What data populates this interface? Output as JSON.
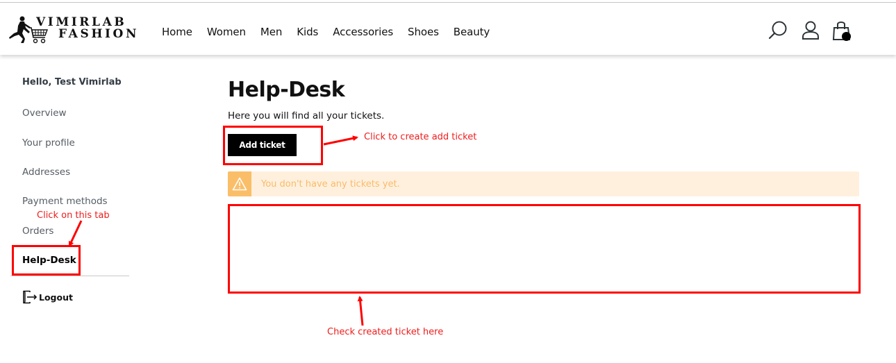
{
  "brand": {
    "line1": "VIMIRLAB",
    "line2": "FASHION",
    "logo_icon": "shopper-with-cart-icon"
  },
  "nav": {
    "items": [
      {
        "label": "Home"
      },
      {
        "label": "Women"
      },
      {
        "label": "Men"
      },
      {
        "label": "Kids"
      },
      {
        "label": "Accessories"
      },
      {
        "label": "Shoes"
      },
      {
        "label": "Beauty"
      }
    ]
  },
  "header_icons": [
    "search-icon",
    "user-icon",
    "shopping-bag-icon"
  ],
  "sidebar": {
    "greeting": "Hello, Test Vimirlab",
    "items": [
      {
        "label": "Overview",
        "active": false
      },
      {
        "label": "Your profile",
        "active": false
      },
      {
        "label": "Addresses",
        "active": false
      },
      {
        "label": "Payment methods",
        "active": false
      },
      {
        "label": "Orders",
        "active": false
      },
      {
        "label": "Help-Desk",
        "active": true
      }
    ],
    "logout_label": "Logout"
  },
  "main": {
    "title": "Help-Desk",
    "subtitle": "Here you will find all your tickets.",
    "add_ticket_label": "Add ticket",
    "alert": {
      "text": "You don't have any tickets yet.",
      "icon": "warning-icon"
    }
  },
  "annotations": {
    "click_tab": "Click on this tab",
    "click_add": "Click to create add ticket",
    "check_ticket": "Check created ticket here"
  },
  "colors": {
    "annotation_red": "#ff0000",
    "alert_bg": "#fff0dd",
    "alert_accent": "#fbbe68",
    "alert_text": "#f8bb6a",
    "button_bg": "#000000"
  }
}
